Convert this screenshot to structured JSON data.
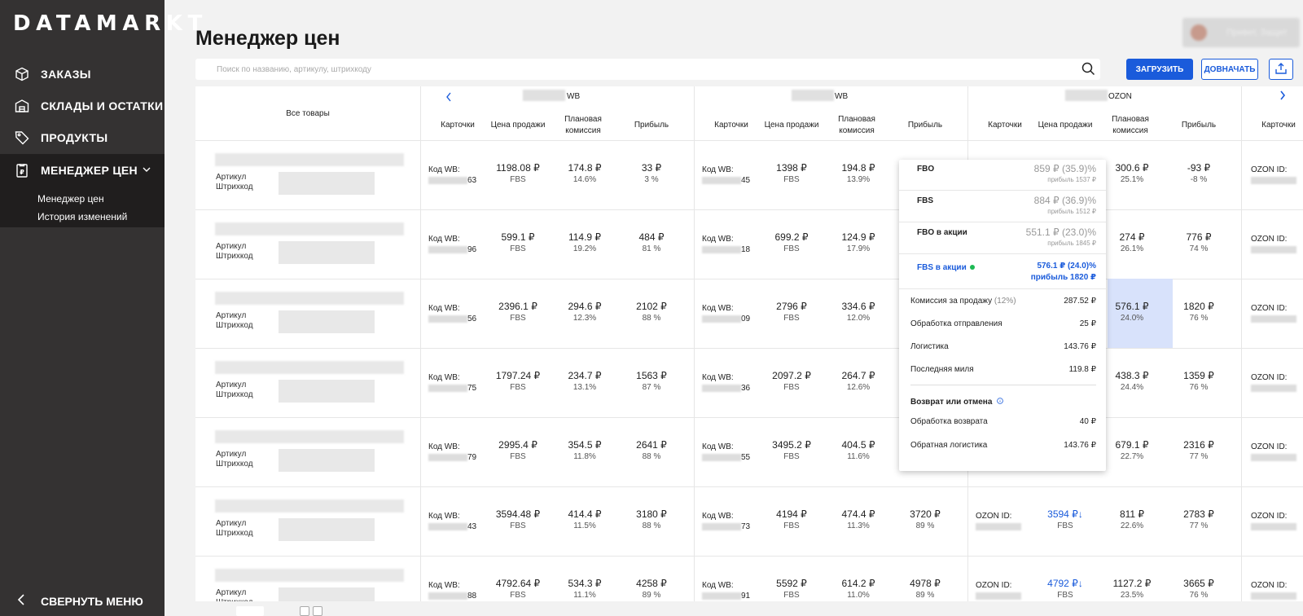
{
  "app": {
    "logo": "DATAMARKT"
  },
  "sidebar": {
    "items": [
      {
        "label": "ЗАКАЗЫ",
        "icon": "box-icon"
      },
      {
        "label": "СКЛАДЫ И ОСТАТКИ",
        "icon": "warehouse-icon"
      },
      {
        "label": "ПРОДУКТЫ",
        "icon": "tag-icon"
      },
      {
        "label": "МЕНЕДЖЕР ЦЕН",
        "icon": "price-doc-icon"
      }
    ],
    "sub_items": [
      "Менеджер цен",
      "История изменений"
    ],
    "collapse_label": "СВЕРНУТЬ МЕНЮ"
  },
  "header": {
    "title": "Менеджер цен",
    "profile_label": "Привет, Защит"
  },
  "search": {
    "placeholder": "Поиск по названию, артикулу, штрихкоду"
  },
  "toolbar": {
    "upload_label": "ЗАГРУЗИТЬ",
    "download_label": "ДОВНАЧАТЬ"
  },
  "table": {
    "all_products_label": "Все товары",
    "marketplaces": [
      "WB",
      "WB",
      "OZON"
    ],
    "columns": [
      "Карточки",
      "Цена продажи",
      "Плановая комиссия",
      "Прибыль"
    ],
    "wb_code_label": "Код WB:",
    "ozon_id_label": "OZON ID:",
    "article_label": "Артикул",
    "barcode_label": "Штрихкод",
    "fbs_label": "FBS",
    "rows": [
      {
        "wb1": {
          "code": "63",
          "price": "1198.08 ₽",
          "comm": "174.8 ₽",
          "comm_pct": "14.6%",
          "profit": "33 ₽",
          "profit_pct": "3 %"
        },
        "wb2": {
          "code": "45",
          "price": "1398 ₽",
          "comm": "194.8 ₽",
          "comm_pct": "13.9%"
        },
        "oz": {
          "comm": "300.6 ₽",
          "comm_pct": "25.1%",
          "profit": "-93 ₽",
          "profit_pct": "-8 %"
        }
      },
      {
        "wb1": {
          "code": "96",
          "price": "599.1 ₽",
          "comm": "114.9 ₽",
          "comm_pct": "19.2%",
          "profit": "484 ₽",
          "profit_pct": "81 %"
        },
        "wb2": {
          "code": "18",
          "price": "699.2 ₽",
          "comm": "124.9 ₽",
          "comm_pct": "17.9%"
        },
        "oz": {
          "comm": "274 ₽",
          "comm_pct": "26.1%",
          "profit": "776 ₽",
          "profit_pct": "74 %"
        }
      },
      {
        "wb1": {
          "code": "56",
          "price": "2396.1 ₽",
          "comm": "294.6 ₽",
          "comm_pct": "12.3%",
          "profit": "2102 ₽",
          "profit_pct": "88 %"
        },
        "wb2": {
          "code": "09",
          "price": "2796 ₽",
          "comm": "334.6 ₽",
          "comm_pct": "12.0%"
        },
        "oz": {
          "comm": "576.1 ₽",
          "comm_pct": "24.0%",
          "profit": "1820 ₽",
          "profit_pct": "76 %"
        }
      },
      {
        "wb1": {
          "code": "75",
          "price": "1797.24 ₽",
          "comm": "234.7 ₽",
          "comm_pct": "13.1%",
          "profit": "1563 ₽",
          "profit_pct": "87 %"
        },
        "wb2": {
          "code": "36",
          "price": "2097.2 ₽",
          "comm": "264.7 ₽",
          "comm_pct": "12.6%"
        },
        "oz": {
          "comm": "438.3 ₽",
          "comm_pct": "24.4%",
          "profit": "1359 ₽",
          "profit_pct": "76 %"
        }
      },
      {
        "wb1": {
          "code": "79",
          "price": "2995.4 ₽",
          "comm": "354.5 ₽",
          "comm_pct": "11.8%",
          "profit": "2641 ₽",
          "profit_pct": "88 %"
        },
        "wb2": {
          "code": "55",
          "price": "3495.2 ₽",
          "comm": "404.5 ₽",
          "comm_pct": "11.6%"
        },
        "oz": {
          "comm": "679.1 ₽",
          "comm_pct": "22.7%",
          "profit": "2316 ₽",
          "profit_pct": "77 %"
        }
      },
      {
        "wb1": {
          "code": "43",
          "price": "3594.48 ₽",
          "comm": "414.4 ₽",
          "comm_pct": "11.5%",
          "profit": "3180 ₽",
          "profit_pct": "88 %"
        },
        "wb2": {
          "code": "73",
          "price": "4194 ₽",
          "comm": "474.4 ₽",
          "comm_pct": "11.3%",
          "profit": "3720 ₽",
          "profit_pct": "89 %"
        },
        "oz": {
          "price": "3594 ₽↓",
          "comm": "811 ₽",
          "comm_pct": "22.6%",
          "profit": "2783 ₽",
          "profit_pct": "77 %"
        }
      },
      {
        "wb1": {
          "code": "88",
          "price": "4792.64 ₽",
          "comm": "534.3 ₽",
          "comm_pct": "11.1%",
          "profit": "4258 ₽",
          "profit_pct": "89 %"
        },
        "wb2": {
          "code": "91",
          "price": "5592 ₽",
          "comm": "614.2 ₽",
          "comm_pct": "11.0%",
          "profit": "4978 ₽",
          "profit_pct": "89 %"
        },
        "oz": {
          "price": "4792 ₽↓",
          "comm": "1127.2 ₽",
          "comm_pct": "23.5%",
          "profit": "3665 ₽",
          "profit_pct": "76 %"
        }
      }
    ]
  },
  "popup": {
    "options": [
      {
        "label": "FBO",
        "value": "859 ₽ (35.9)%",
        "profit": "прибыль 1537 ₽"
      },
      {
        "label": "FBS",
        "value": "884 ₽ (36.9)%",
        "profit": "прибыль 1512 ₽"
      },
      {
        "label": "FBO в акции",
        "value": "551.1 ₽ (23.0)%",
        "profit": "прибыль 1845 ₽"
      },
      {
        "label": "FBS в акции",
        "value": "576.1 ₽ (24.0)%",
        "profit": "прибыль 1820 ₽"
      }
    ],
    "commission_label": "Комиссия за продажу",
    "commission_pct": "(12%)",
    "commission_value": "287.52 ₽",
    "lines": [
      {
        "label": "Обработка отправления",
        "value": "25 ₽"
      },
      {
        "label": "Логистика",
        "value": "143.76 ₽"
      },
      {
        "label": "Последняя миля",
        "value": "119.8 ₽"
      }
    ],
    "return_title": "Возврат или отмена",
    "return_lines": [
      {
        "label": "Обработка возврата",
        "value": "40 ₽"
      },
      {
        "label": "Обратная логистика",
        "value": "143.76 ₽"
      }
    ]
  },
  "colors": {
    "accent": "#1a5bdb",
    "sidebar": "#343232",
    "highlight": "#d8e2fb",
    "active_dot": "#1db954"
  }
}
